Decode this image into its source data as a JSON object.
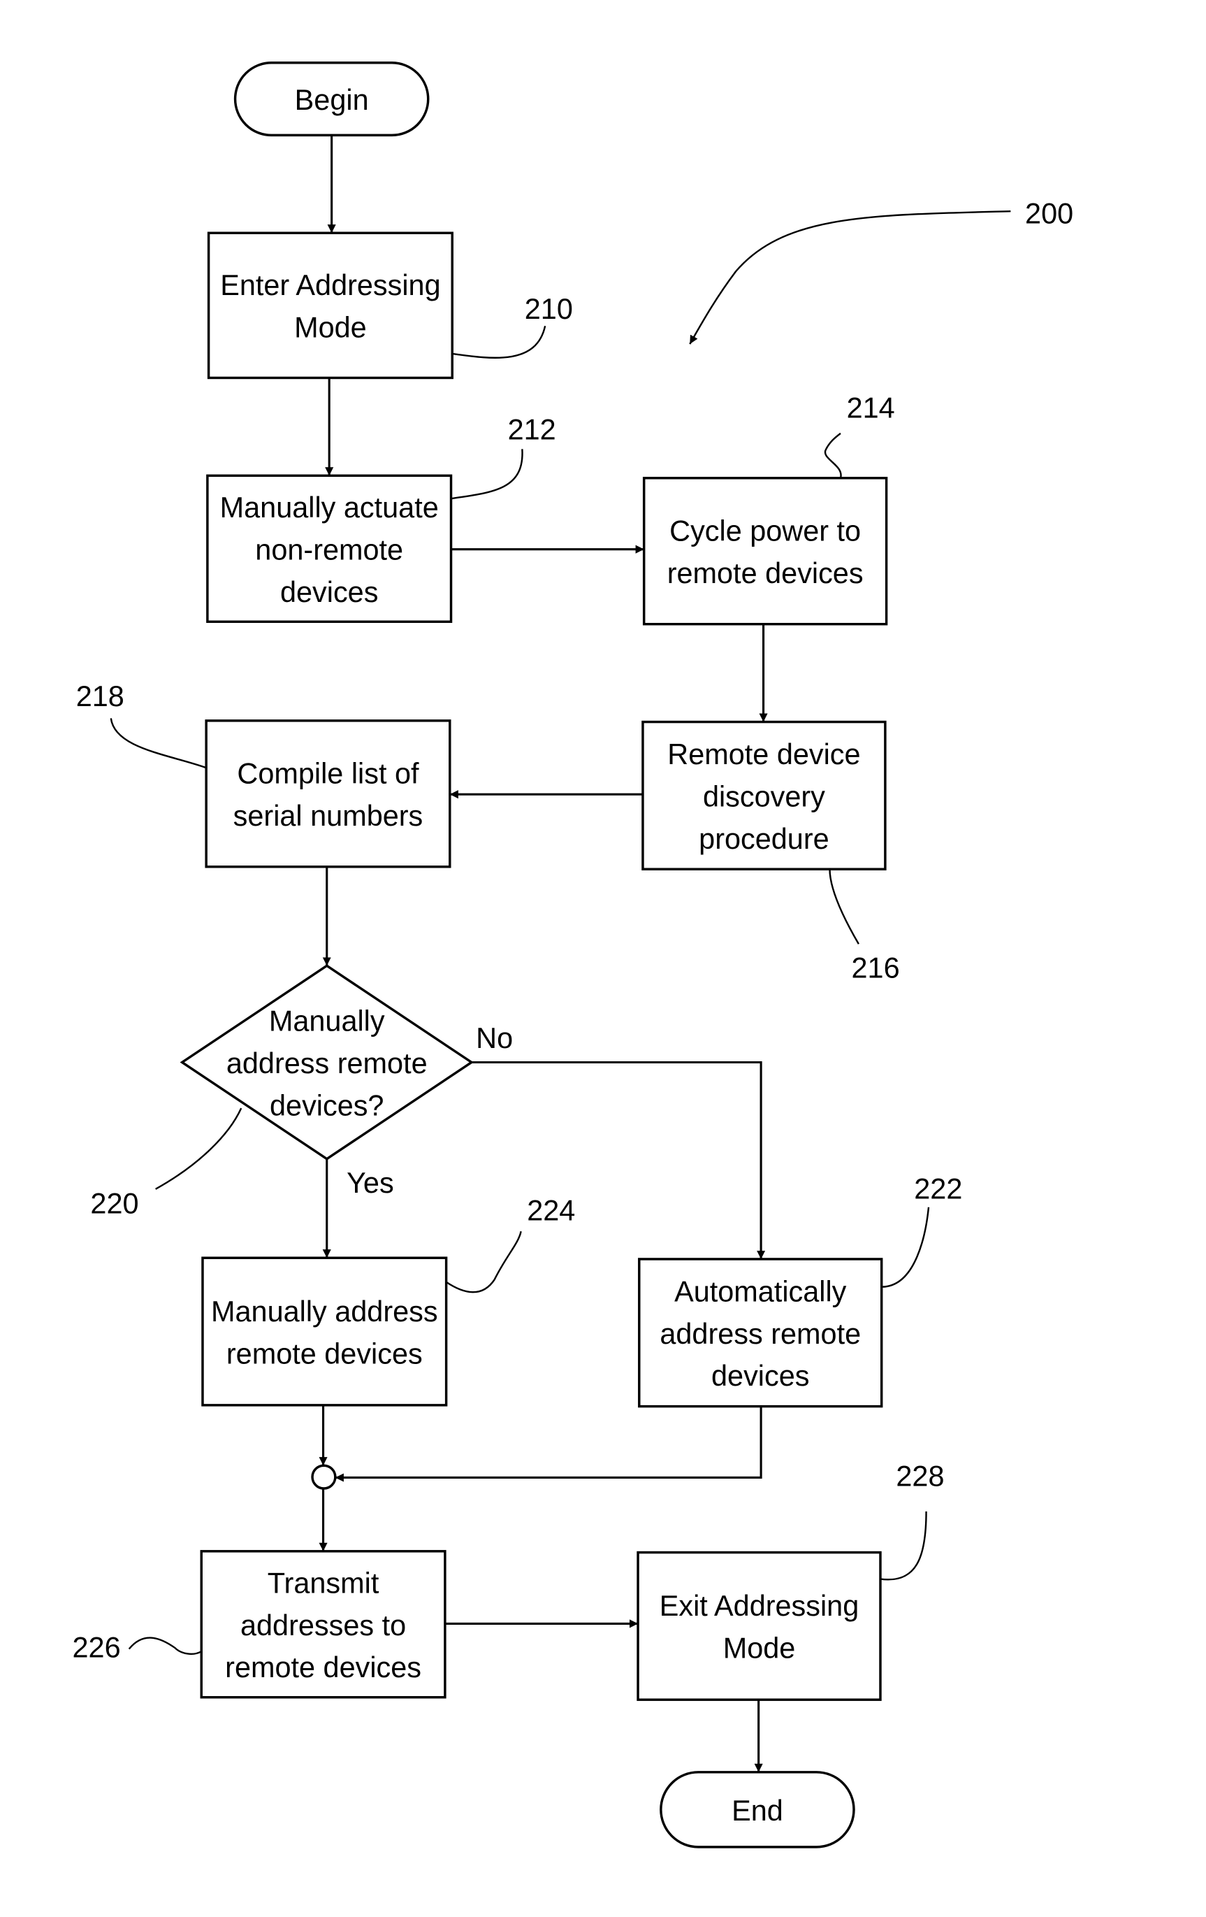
{
  "figure": {
    "reference": "200",
    "nodes": [
      {
        "id": "begin",
        "type": "terminal",
        "lines": [
          "Begin"
        ],
        "ref": ""
      },
      {
        "id": "210",
        "type": "process",
        "lines": [
          "Enter Addressing",
          "Mode"
        ],
        "ref": "210"
      },
      {
        "id": "212",
        "type": "process",
        "lines": [
          "Manually actuate",
          "non-remote",
          "devices"
        ],
        "ref": "212"
      },
      {
        "id": "214",
        "type": "process",
        "lines": [
          "Cycle power to",
          "remote devices"
        ],
        "ref": "214"
      },
      {
        "id": "216",
        "type": "process",
        "lines": [
          "Remote device",
          "discovery",
          "procedure"
        ],
        "ref": "216"
      },
      {
        "id": "218",
        "type": "process",
        "lines": [
          "Compile list of",
          "serial numbers"
        ],
        "ref": "218"
      },
      {
        "id": "220",
        "type": "decision",
        "lines": [
          "Manually",
          "address remote",
          "devices?"
        ],
        "ref": "220"
      },
      {
        "id": "222",
        "type": "process",
        "lines": [
          "Automatically",
          "address remote",
          "devices"
        ],
        "ref": "222"
      },
      {
        "id": "224",
        "type": "process",
        "lines": [
          "Manually address",
          "remote devices"
        ],
        "ref": "224"
      },
      {
        "id": "join",
        "type": "connector",
        "lines": [],
        "ref": ""
      },
      {
        "id": "226",
        "type": "process",
        "lines": [
          "Transmit",
          "addresses to",
          "remote devices"
        ],
        "ref": "226"
      },
      {
        "id": "228",
        "type": "process",
        "lines": [
          "Exit Addressing",
          "Mode"
        ],
        "ref": "228"
      },
      {
        "id": "end",
        "type": "terminal",
        "lines": [
          "End"
        ],
        "ref": ""
      }
    ],
    "edges": [
      {
        "from": "begin",
        "to": "210",
        "label": ""
      },
      {
        "from": "210",
        "to": "212",
        "label": ""
      },
      {
        "from": "212",
        "to": "214",
        "label": ""
      },
      {
        "from": "214",
        "to": "216",
        "label": ""
      },
      {
        "from": "216",
        "to": "218",
        "label": ""
      },
      {
        "from": "218",
        "to": "220",
        "label": ""
      },
      {
        "from": "220",
        "to": "222",
        "label": "No"
      },
      {
        "from": "220",
        "to": "224",
        "label": "Yes"
      },
      {
        "from": "224",
        "to": "join",
        "label": ""
      },
      {
        "from": "222",
        "to": "join",
        "label": ""
      },
      {
        "from": "join",
        "to": "226",
        "label": ""
      },
      {
        "from": "226",
        "to": "228",
        "label": ""
      },
      {
        "from": "228",
        "to": "end",
        "label": ""
      }
    ]
  }
}
